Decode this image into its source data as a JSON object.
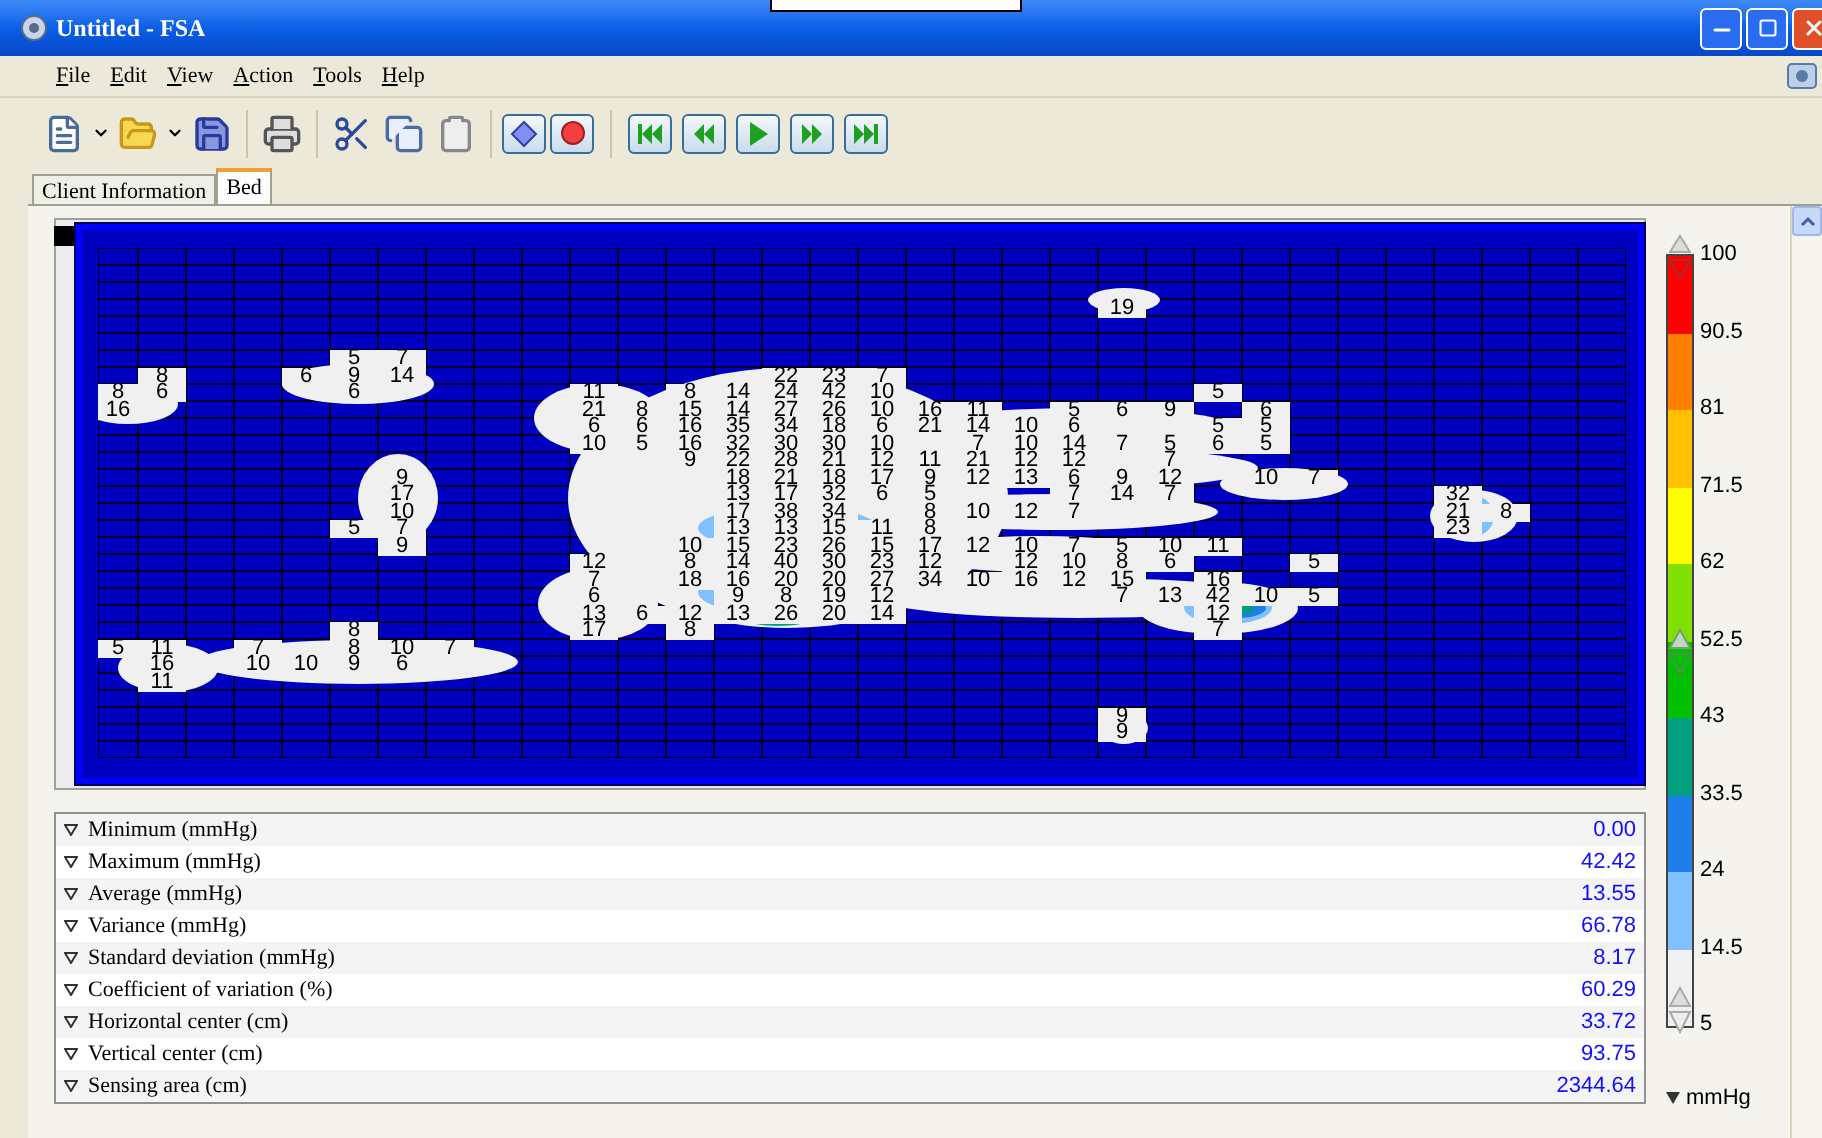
{
  "window": {
    "title": "Untitled - FSA"
  },
  "menu": [
    "File",
    "Edit",
    "View",
    "Action",
    "Tools",
    "Help"
  ],
  "tabs": [
    {
      "label": "Client Information",
      "selected": false
    },
    {
      "label": "Bed",
      "selected": true
    }
  ],
  "pressure_map": {
    "rows": [
      null,
      null,
      null,
      [
        null,
        null,
        null,
        null,
        null,
        null,
        null,
        null,
        null,
        null,
        null,
        null,
        null,
        null,
        null,
        null,
        null,
        null,
        null,
        null,
        null,
        "19"
      ],
      null,
      null,
      [
        null,
        null,
        null,
        null,
        null,
        "5",
        "7"
      ],
      [
        null,
        "8",
        null,
        null,
        "6",
        "9",
        "14",
        null,
        null,
        null,
        null,
        null,
        null,
        null,
        "22",
        "23",
        "7"
      ],
      [
        "8",
        "6",
        null,
        null,
        null,
        "6",
        null,
        null,
        null,
        null,
        "11",
        null,
        "8",
        "14",
        "24",
        "42",
        "10",
        null,
        null,
        null,
        null,
        null,
        null,
        "5"
      ],
      [
        "16",
        null,
        null,
        null,
        null,
        null,
        null,
        null,
        null,
        null,
        "21",
        "8",
        "15",
        "14",
        "27",
        "26",
        "10",
        "16",
        "11",
        null,
        "5",
        "6",
        "9",
        null,
        "6"
      ],
      [
        null,
        null,
        null,
        null,
        null,
        null,
        null,
        null,
        null,
        null,
        "6",
        "6",
        "16",
        "35",
        "34",
        "18",
        "6",
        "21",
        "14",
        "10",
        "6",
        null,
        null,
        "5",
        "5"
      ],
      [
        null,
        null,
        null,
        null,
        null,
        null,
        null,
        null,
        null,
        null,
        "10",
        "5",
        "16",
        "32",
        "30",
        "30",
        "10",
        null,
        "7",
        "10",
        "14",
        "7",
        "5",
        "6",
        "5"
      ],
      [
        null,
        null,
        null,
        null,
        null,
        null,
        null,
        null,
        null,
        null,
        null,
        null,
        "9",
        "22",
        "28",
        "21",
        "12",
        "11",
        "21",
        "12",
        "12",
        null,
        "7"
      ],
      [
        null,
        null,
        null,
        null,
        null,
        null,
        "9",
        null,
        null,
        null,
        null,
        null,
        null,
        "18",
        "21",
        "18",
        "17",
        "9",
        "12",
        "13",
        "6",
        "9",
        "12",
        null,
        "10",
        "7"
      ],
      [
        null,
        null,
        null,
        null,
        null,
        null,
        "17",
        null,
        null,
        null,
        null,
        null,
        null,
        "13",
        "17",
        "32",
        "6",
        "5",
        null,
        null,
        "7",
        "14",
        "7",
        null,
        null,
        null,
        null,
        null,
        "32"
      ],
      [
        null,
        null,
        null,
        null,
        null,
        null,
        "10",
        null,
        null,
        null,
        null,
        null,
        null,
        "17",
        "38",
        "34",
        null,
        "8",
        "10",
        "12",
        "7",
        null,
        null,
        null,
        null,
        null,
        null,
        null,
        "21",
        "8"
      ],
      [
        null,
        null,
        null,
        null,
        null,
        "5",
        "7",
        null,
        null,
        null,
        null,
        null,
        null,
        "13",
        "13",
        "15",
        "11",
        "8",
        null,
        null,
        null,
        null,
        null,
        null,
        null,
        null,
        null,
        null,
        "23"
      ],
      [
        null,
        null,
        null,
        null,
        null,
        null,
        "9",
        null,
        null,
        null,
        null,
        null,
        "10",
        "15",
        "23",
        "26",
        "15",
        "17",
        "12",
        "10",
        "7",
        "5",
        "10",
        "11"
      ],
      [
        null,
        null,
        null,
        null,
        null,
        null,
        null,
        null,
        null,
        null,
        "12",
        null,
        "8",
        "14",
        "40",
        "30",
        "23",
        "12",
        null,
        "12",
        "10",
        "8",
        "6",
        null,
        null,
        "5"
      ],
      [
        null,
        null,
        null,
        null,
        null,
        null,
        null,
        null,
        null,
        null,
        "7",
        null,
        "18",
        "16",
        "20",
        "20",
        "27",
        "34",
        "10",
        "16",
        "12",
        "15",
        null,
        "16"
      ],
      [
        null,
        null,
        null,
        null,
        null,
        null,
        null,
        null,
        null,
        null,
        "6",
        null,
        null,
        "9",
        "8",
        "19",
        "12",
        null,
        null,
        null,
        null,
        "7",
        "13",
        "42",
        "10",
        "5"
      ],
      [
        null,
        null,
        null,
        null,
        null,
        null,
        null,
        null,
        null,
        null,
        "13",
        "6",
        "12",
        "13",
        "26",
        "20",
        "14",
        null,
        null,
        null,
        null,
        null,
        null,
        "12"
      ],
      [
        null,
        null,
        null,
        null,
        null,
        "8",
        null,
        null,
        null,
        null,
        "17",
        null,
        "8",
        null,
        null,
        null,
        null,
        null,
        null,
        null,
        null,
        null,
        null,
        "7"
      ],
      [
        "5",
        "11",
        null,
        "7",
        null,
        "8",
        "10",
        "7"
      ],
      [
        null,
        "16",
        null,
        "10",
        "10",
        "9",
        "6"
      ],
      [
        null,
        "11"
      ],
      null,
      [
        null,
        null,
        null,
        null,
        null,
        null,
        null,
        null,
        null,
        null,
        null,
        null,
        null,
        null,
        null,
        null,
        null,
        null,
        null,
        null,
        null,
        "9"
      ],
      [
        null,
        null,
        null,
        null,
        null,
        null,
        null,
        null,
        null,
        null,
        null,
        null,
        null,
        null,
        null,
        null,
        null,
        null,
        null,
        null,
        null,
        "9"
      ],
      null
    ]
  },
  "stats": [
    {
      "label": "Minimum (mmHg)",
      "value": "0.00"
    },
    {
      "label": "Maximum (mmHg)",
      "value": "42.42"
    },
    {
      "label": "Average (mmHg)",
      "value": "13.55"
    },
    {
      "label": "Variance (mmHg)",
      "value": "66.78"
    },
    {
      "label": "Standard deviation (mmHg)",
      "value": "8.17"
    },
    {
      "label": "Coefficient of variation (%)",
      "value": "60.29"
    },
    {
      "label": "Horizontal center (cm)",
      "value": "33.72"
    },
    {
      "label": "Vertical center (cm)",
      "value": "93.75"
    },
    {
      "label": "Sensing area (cm)",
      "value": "2344.64"
    }
  ],
  "legend": {
    "labels": [
      "100",
      "90.5",
      "81",
      "71.5",
      "62",
      "52.5",
      "43",
      "33.5",
      "24",
      "14.5",
      "5"
    ],
    "segments": [
      {
        "color": "#ff0000"
      },
      {
        "color": "#ff8000"
      },
      {
        "color": "#ffc000"
      },
      {
        "color": "#ffff00"
      },
      {
        "color": "#80e000"
      },
      {
        "color": "#00c000"
      },
      {
        "color": "#00a080"
      },
      {
        "color": "#1e7fe8"
      },
      {
        "color": "#80c0ff"
      },
      {
        "color": "#f0f0f0"
      }
    ],
    "unit": "mmHg"
  }
}
